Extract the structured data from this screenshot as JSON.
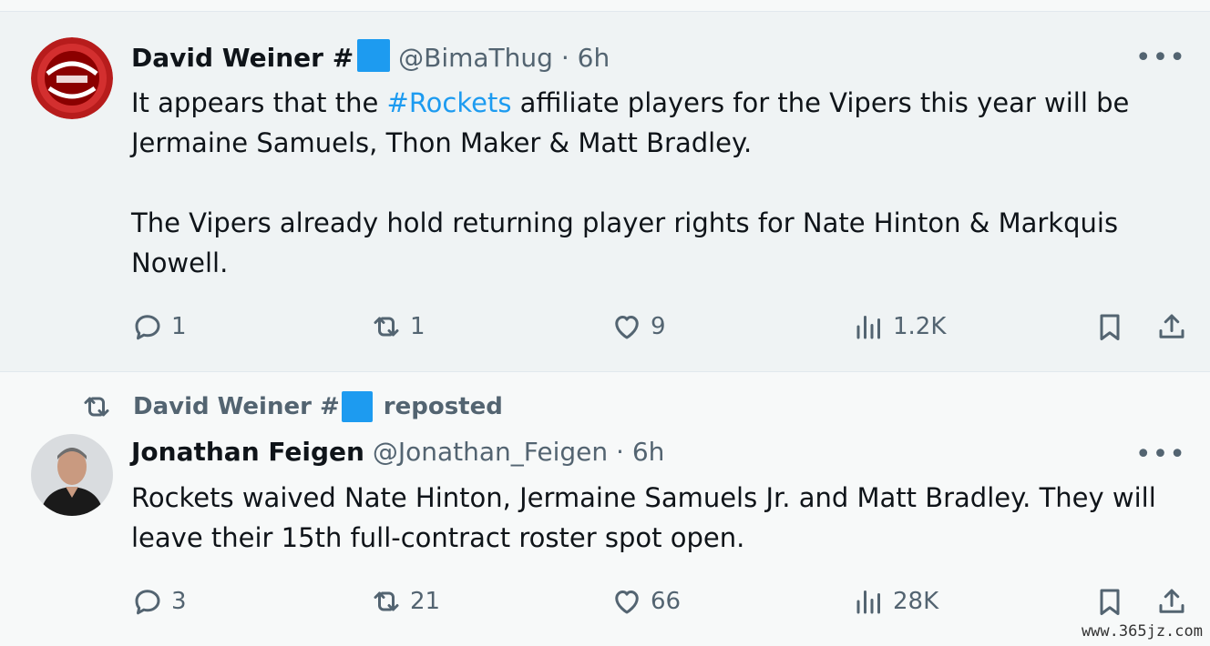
{
  "tweet1": {
    "name": "David Weiner #",
    "handle": "@BimaThug",
    "separator": "·",
    "time": "6h",
    "text_part1": "It appears that the ",
    "hashtag": "#Rockets",
    "text_part2": " affiliate players for the Vipers this year will be Jermaine Samuels, Thon Maker & Matt Bradley.",
    "paragraph2": "The Vipers already hold returning player rights for Nate Hinton & Markquis Nowell.",
    "replies": "1",
    "reposts": "1",
    "likes": "9",
    "views": "1.2K"
  },
  "repost_banner": {
    "name": "David Weiner #",
    "label": "reposted"
  },
  "tweet2": {
    "name": "Jonathan Feigen",
    "handle": "@Jonathan_Feigen",
    "separator": "·",
    "time": "6h",
    "text": "Rockets waived Nate Hinton, Jermaine Samuels Jr. and Matt Bradley. They will leave their 15th full-contract roster spot open.",
    "replies": "3",
    "reposts": "21",
    "likes": "66",
    "views": "28K"
  },
  "more_label": "•••",
  "watermark": "www.365jz.com",
  "colors": {
    "accent": "#1d9bf0",
    "text": "#0f1419",
    "muted": "#536471"
  }
}
